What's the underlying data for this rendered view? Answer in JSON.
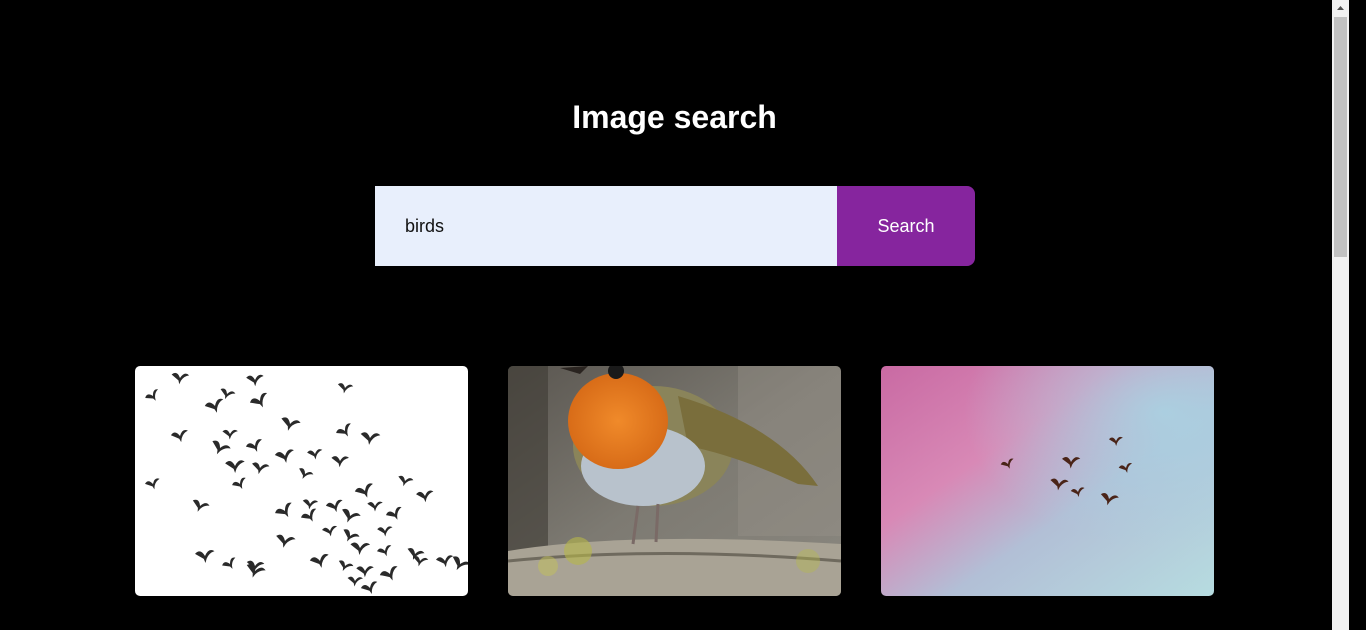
{
  "page": {
    "title": "Image search"
  },
  "search": {
    "value": "birds",
    "button_label": "Search"
  },
  "results": [
    {
      "name": "flock-of-birds-image",
      "description_icon": "flock-silhouette"
    },
    {
      "name": "robin-image",
      "description_icon": "robin-photo"
    },
    {
      "name": "birds-in-pink-sky-image",
      "description_icon": "birds-sky"
    }
  ],
  "colors": {
    "background": "#000000",
    "accent": "#86259e",
    "input_background": "#e8effc"
  }
}
